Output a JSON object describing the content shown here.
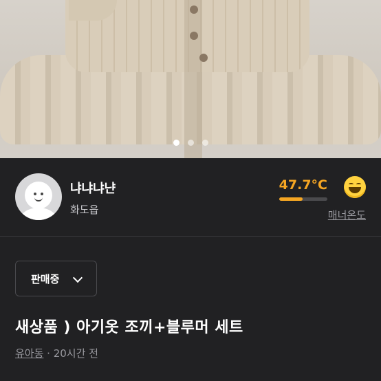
{
  "image_carousel": {
    "total": 3,
    "active_index": 0
  },
  "seller": {
    "nickname": "냐냐냐냔",
    "location": "화도읍",
    "manner_temperature": "47.7°C",
    "manner_progress": 0.48,
    "manner_label": "매너온도",
    "emoji": "grinning-face-icon"
  },
  "status_dropdown": {
    "selected": "판매중"
  },
  "listing": {
    "title": "새상품 ) 아기옷 조끼+블루머 세트",
    "category": "유아동",
    "separator": " · ",
    "time_ago": "20시간 전"
  },
  "colors": {
    "accent": "#f5a623",
    "background": "#212123"
  }
}
